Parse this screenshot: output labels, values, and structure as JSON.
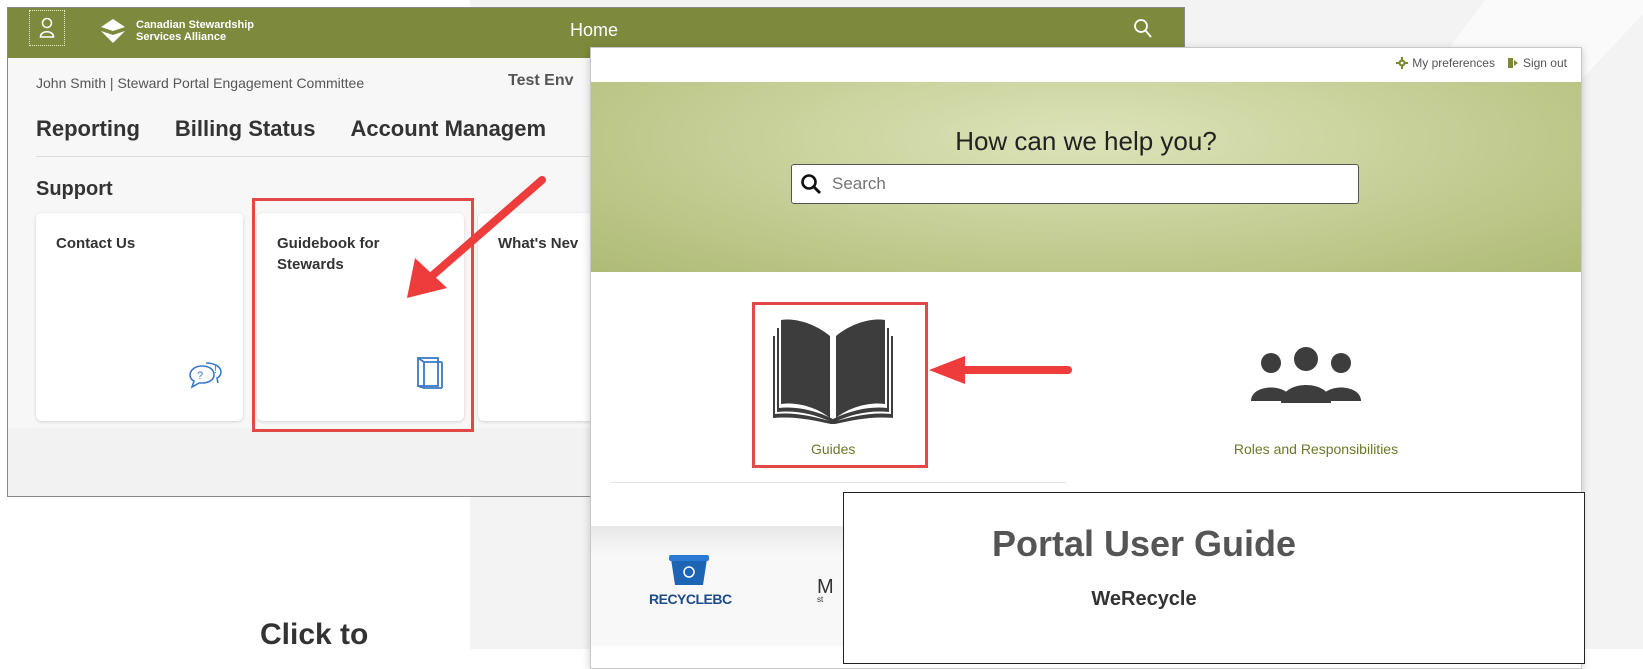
{
  "portal": {
    "brand_line1": "Canadian Stewardship",
    "brand_line2": "Services Alliance",
    "header_title": "Home",
    "user_line": "John Smith | Steward Portal Engagement Committee",
    "environment": "Test Env",
    "nav": [
      "Reporting",
      "Billing Status",
      "Account Managem"
    ],
    "support_title": "Support",
    "tiles": [
      {
        "label": "Contact Us",
        "icon": "feedback-icon"
      },
      {
        "label": "Guidebook for Stewards",
        "icon": "book-icon"
      },
      {
        "label": "What's Nev",
        "icon": ""
      }
    ],
    "header_color": "#7d8a3d"
  },
  "help_center": {
    "preferences_label": "My preferences",
    "signout_label": "Sign out",
    "hero_title": "How can we help you?",
    "search_placeholder": "Search",
    "categories": [
      {
        "label": "Guides",
        "icon": "open-book-icon"
      },
      {
        "label": "Roles and Responsibilities",
        "icon": "people-group-icon"
      }
    ],
    "footer_logo_text": "RECYCLEBC",
    "footer_partial_text": "M",
    "footer_partial_sub": "st"
  },
  "guide_doc": {
    "title": "Portal User Guide",
    "subtitle": "WeRecycle"
  },
  "caption_partial": "Click to",
  "highlight_color": "#e34848"
}
